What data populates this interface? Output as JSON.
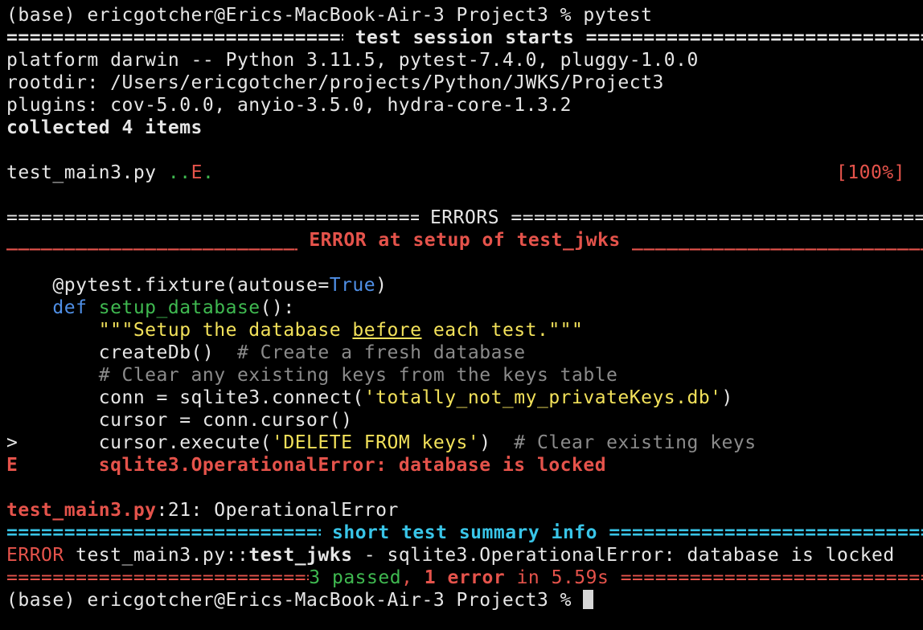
{
  "prompt": {
    "start": "(base) ericgotcher@Erics-MacBook-Air-3 Project3 % pytest",
    "end": "(base) ericgotcher@Erics-MacBook-Air-3 Project3 % "
  },
  "session": {
    "header": " test session starts ",
    "platform": "platform darwin -- Python 3.11.5, pytest-7.4.0, pluggy-1.0.0",
    "rootdir": "rootdir: /Users/ericgotcher/projects/Python/JWKS/Project3",
    "plugins": "plugins: cov-5.0.0, anyio-3.5.0, hydra-core-1.3.2",
    "collected": "collected 4 items"
  },
  "progress": {
    "file": "test_main3.py ",
    "dots": "..",
    "error_char": "E",
    "dot": ".",
    "percent": "[100%]"
  },
  "errors": {
    "header": " ERRORS ",
    "setup_header": " ERROR at setup of test_jwks ",
    "code": {
      "line1_a": "    @pytest.fixture(autouse=",
      "line1_true": "True",
      "line1_b": ")",
      "line2_def": "    def ",
      "line2_name": "setup_database",
      "line2_rest": "():",
      "line3_a": "        \"\"\"Setup the database ",
      "line3_u": "before",
      "line3_b": " each test.\"\"\"",
      "line4_a": "        createDb()  ",
      "line4_comment": "# Create a fresh database",
      "line5": "        # Clear any existing keys from the keys table",
      "line6_a": "        conn = sqlite3.connect(",
      "line6_str": "'totally_not_my_privateKeys.db'",
      "line6_b": ")",
      "line7": "        cursor = conn.cursor()",
      "line8_marker": ">",
      "line8_a": "       cursor.execute(",
      "line8_str": "'DELETE FROM keys'",
      "line8_b": ")  ",
      "line8_comment": "# Clear existing keys",
      "line9_marker": "E",
      "line9_text": "       sqlite3.OperationalError: database is locked"
    },
    "location_file": "test_main3.py",
    "location_rest": ":21: OperationalError"
  },
  "summary": {
    "header": " short test summary info ",
    "error_label": "ERROR",
    "error_test_prefix": " test_main3.py::",
    "error_test_name": "test_jwks",
    "error_msg": " - sqlite3.OperationalError: database is locked",
    "passed": "3 passed",
    "comma": ", ",
    "errors": "1 error",
    "time": " in 5.59s "
  },
  "fill_char": "==================================================================================================",
  "underscore_fill": "__________________________________________________________________________________________________",
  "colors": {
    "background": "#000000",
    "text": "#e6e6e6",
    "red": "#e5534b",
    "green": "#3fb950",
    "cyan": "#39c5e8",
    "blue": "#4f8fe6",
    "yellow": "#f2e15a",
    "comment": "#8b8b8b"
  }
}
